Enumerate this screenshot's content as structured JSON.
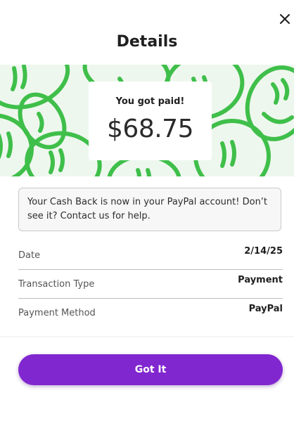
{
  "dialog": {
    "title": "Details",
    "close_icon": "close-icon"
  },
  "banner": {
    "pattern_color": "#3fbf4a",
    "background_color": "#eef7ee",
    "paid_label": "You got paid!",
    "amount": "$68.75"
  },
  "notice": {
    "text": "Your Cash Back is now in your PayPal account! Don’t see it? Contact us for help."
  },
  "details": [
    {
      "label": "Date",
      "value": "2/14/25"
    },
    {
      "label": "Transaction Type",
      "value": "Payment"
    },
    {
      "label": "Payment Method",
      "value": "PayPal"
    }
  ],
  "primary_button": {
    "label": "Got It",
    "color": "#8127cf"
  }
}
